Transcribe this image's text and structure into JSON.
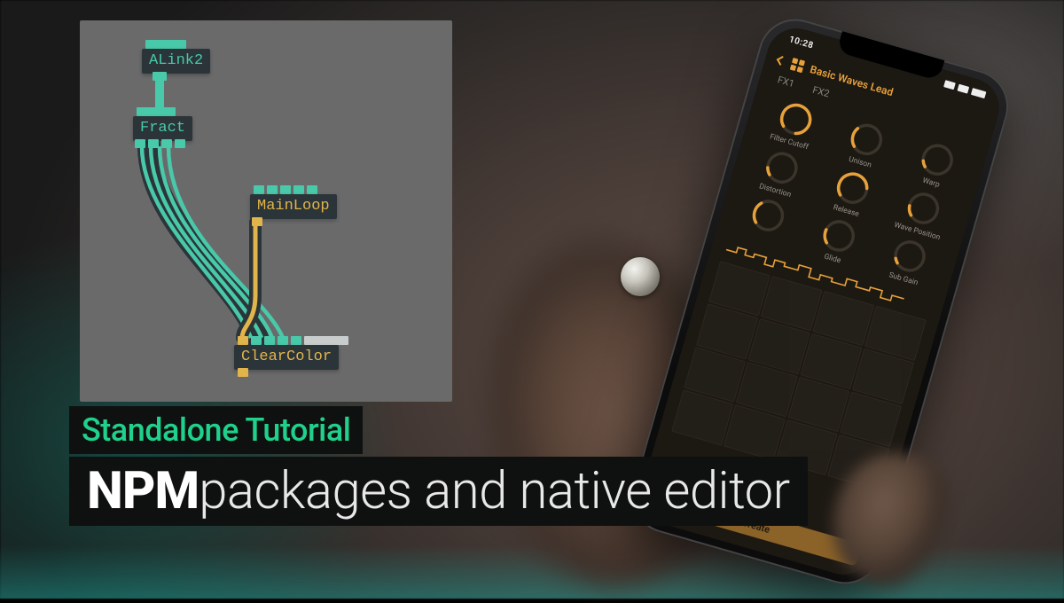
{
  "overlay": {
    "subtitle": "Standalone Tutorial",
    "title_bold": "NPM",
    "title_rest": " packages and native editor"
  },
  "graph": {
    "nodes": {
      "alink2": "ALink2",
      "fract": "Fract",
      "mainloop": "MainLoop",
      "clearcolor": "ClearColor"
    }
  },
  "phone": {
    "status_time": "10:28",
    "patch_name": "Basic Waves Lead",
    "tabs": {
      "fx1": "FX1",
      "fx2": "FX2"
    },
    "knobs": [
      {
        "label": "Filter Cutoff",
        "arc": 300
      },
      {
        "label": "Unison",
        "arc": 80
      },
      {
        "label": "Warp",
        "arc": 25
      },
      {
        "label": "Distortion",
        "arc": 30
      },
      {
        "label": "Release",
        "arc": 210
      },
      {
        "label": "Wave Position",
        "arc": 40
      },
      {
        "label": "",
        "arc": 90
      },
      {
        "label": "Glide",
        "arc": 55
      },
      {
        "label": "Sub Gain",
        "arc": 20
      }
    ],
    "bottom_button": "Create"
  },
  "colors": {
    "teal": "#48c9a9",
    "yellow": "#e1b54b",
    "accent_green": "#1fd18a",
    "phone_accent": "#e7a13a"
  }
}
